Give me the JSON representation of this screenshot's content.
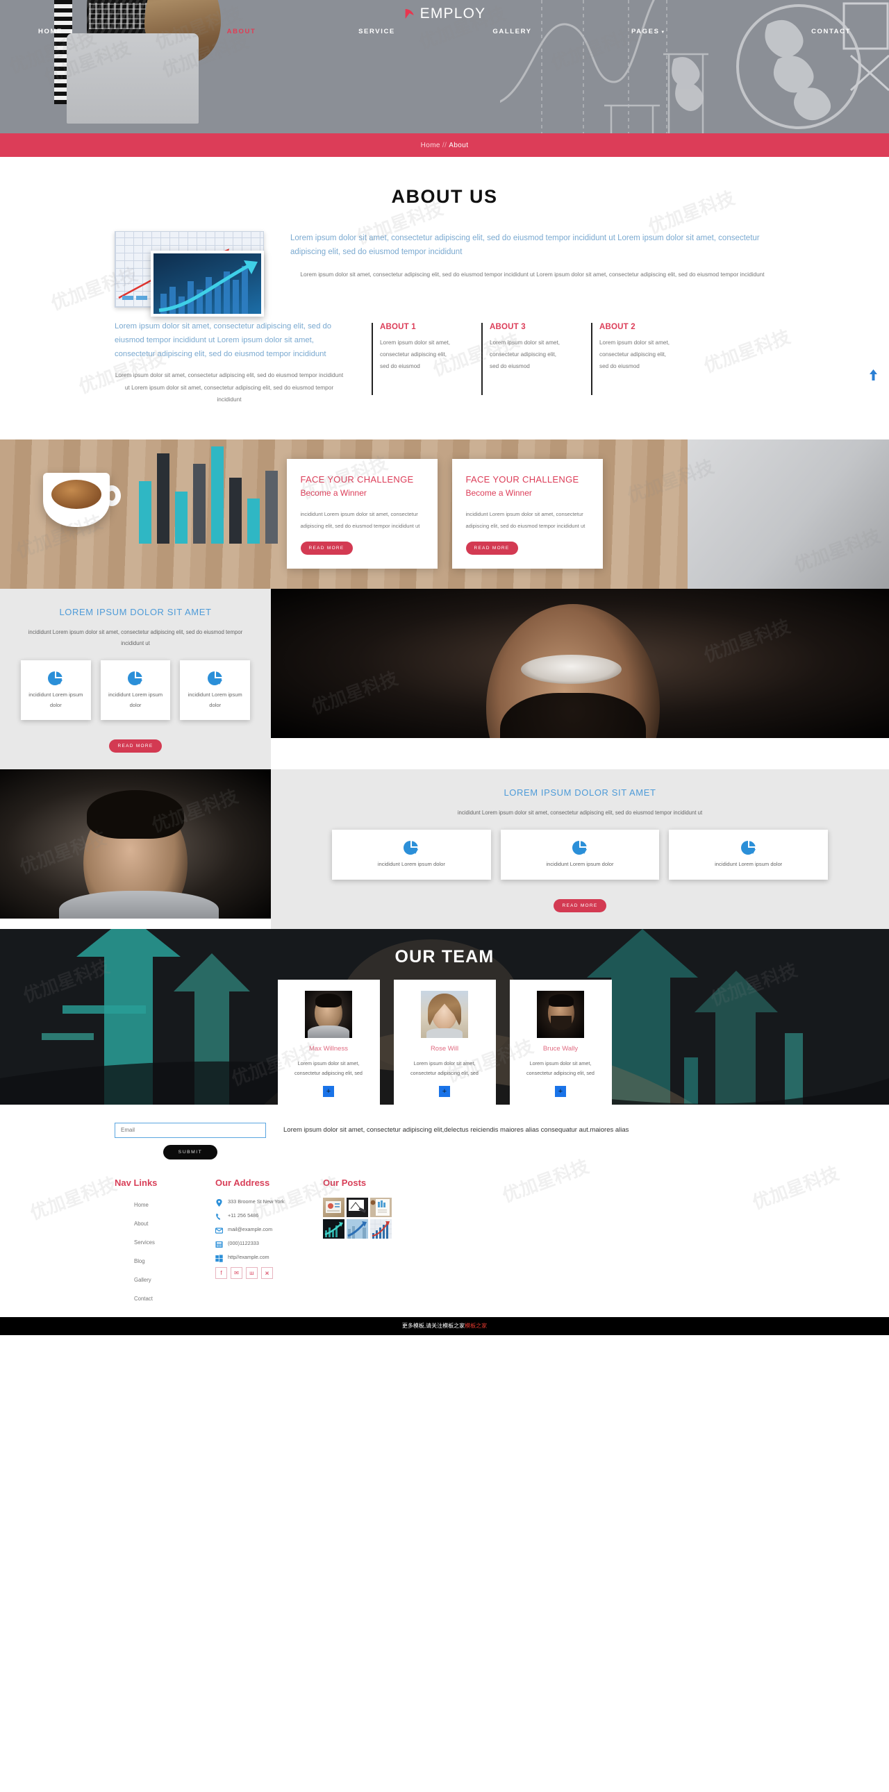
{
  "brand": {
    "name": "EMPLOY",
    "logo_icon": "flag-mark-icon",
    "accent": "#dc3d58",
    "blue": "#4e9bd8"
  },
  "nav": {
    "items": [
      {
        "label": "HOME",
        "active": false
      },
      {
        "label": "ABOUT",
        "active": true
      },
      {
        "label": "SERVICE",
        "active": false
      },
      {
        "label": "GALLERY",
        "active": false
      },
      {
        "label": "PAGES",
        "active": false,
        "caret": "▾"
      },
      {
        "label": "CONTACT",
        "active": false
      }
    ]
  },
  "breadcrumb": {
    "home": "Home",
    "separator": "//",
    "current": "About"
  },
  "about": {
    "title": "ABOUT US",
    "lead_right": "Lorem ipsum dolor sit amet, consectetur adipiscing elit, sed do eiusmod tempor incididunt ut Lorem ipsum dolor sit amet, consectetur adipiscing elit, sed do eiusmod tempor incididunt",
    "sub_right": "Lorem ipsum dolor sit amet, consectetur adipiscing elit, sed do eiusmod tempor incididunt ut Lorem ipsum dolor sit amet, consectetur adipiscing elit, sed do eiusmod tempor incididunt",
    "lead_left": "Lorem ipsum dolor sit amet, consectetur adipiscing elit, sed do eiusmod tempor incididunt ut Lorem ipsum dolor sit amet, consectetur adipiscing elit, sed do eiusmod tempor incididunt",
    "sub_left": "Lorem ipsum dolor sit amet, consectetur adipiscing elit, sed do eiusmod tempor incididunt ut Lorem ipsum dolor sit amet, consectetur adipiscing elit, sed do eiusmod tempor incididunt",
    "features": [
      {
        "title": "ABOUT 1",
        "text": "Lorem ipsum dolor sit amet, consectetur adipiscing elit, sed do eiusmod"
      },
      {
        "title": "ABOUT 3",
        "text": "Lorem ipsum dolor sit amet, consectetur adipiscing elit, sed do eiusmod"
      },
      {
        "title": "ABOUT 2",
        "text": "Lorem ipsum dolor sit amet, consectetur adipiscing elit, sed do eiusmod"
      }
    ],
    "scroll_top_icon": "scroll-to-top-icon"
  },
  "challenge": {
    "cards": [
      {
        "heading": "FACE YOUR CHALLENGE",
        "subheading": "Become a Winner",
        "text": "incididunt Lorem ipsum dolor sit amet, consectetur adipiscing elit, sed do eiusmod tempor incididunt ut",
        "button": "READ MORE"
      },
      {
        "heading": "FACE YOUR CHALLENGE",
        "subheading": "Become a Winner",
        "text": "incididunt Lorem ipsum dolor sit amet, consectetur adipiscing elit, sed do eiusmod tempor incididunt ut",
        "button": "READ MORE"
      }
    ]
  },
  "services": [
    {
      "title": "LOREM IPSUM DOLOR SIT AMET",
      "desc": "incididunt Lorem ipsum dolor sit amet, consectetur adipiscing elit, sed do eiusmod tempor incididunt ut",
      "cards": [
        {
          "icon": "pie-chart-icon",
          "text": "incididunt Lorem ipsum dolor"
        },
        {
          "icon": "pie-chart-icon",
          "text": "incididunt Lorem ipsum dolor"
        },
        {
          "icon": "pie-chart-icon",
          "text": "incididunt Lorem ipsum dolor"
        }
      ],
      "button": "READ MORE"
    },
    {
      "title": "LOREM IPSUM DOLOR SIT AMET",
      "desc": "incididunt Lorem ipsum dolor sit amet, consectetur adipiscing elit, sed do eiusmod tempor incididunt ut",
      "cards": [
        {
          "icon": "pie-chart-icon",
          "text": "incididunt Lorem ipsum dolor"
        },
        {
          "icon": "pie-chart-icon",
          "text": "incididunt Lorem ipsum dolor"
        },
        {
          "icon": "pie-chart-icon",
          "text": "incididunt Lorem ipsum dolor"
        }
      ],
      "button": "READ MORE"
    }
  ],
  "team": {
    "title": "OUR TEAM",
    "members": [
      {
        "name": "Max Willness",
        "bio": "Lorem ipsum dolor sit amet, consectetur adipiscing elit, sed",
        "expand": "+"
      },
      {
        "name": "Rose Will",
        "bio": "Lorem ipsum dolor sit amet, consectetur adipiscing elit, sed",
        "expand": "+"
      },
      {
        "name": "Bruce Wally",
        "bio": "Lorem ipsum dolor sit amet, consectetur adipiscing elit, sed",
        "expand": "+"
      }
    ]
  },
  "footer": {
    "email_placeholder": "Email",
    "email_value": "",
    "submit_label": "SUBMIT",
    "blurb": "Lorem ipsum dolor sit amet, consectetur adipiscing elit,delectus reiciendis maiores alias consequatur aut.maiores alias",
    "nav": {
      "title": "Nav Links",
      "items": [
        "Home",
        "About",
        "Services",
        "Blog",
        "Gallery",
        "Contact"
      ]
    },
    "address": {
      "title": "Our Address",
      "lines": [
        {
          "icon": "location-pin-icon",
          "text": "333 Broome St New York"
        },
        {
          "icon": "phone-icon",
          "text": "+11 256 5486"
        },
        {
          "icon": "mail-icon",
          "text": "mail@example.com"
        },
        {
          "icon": "fax-icon",
          "text": "(000)1122333"
        },
        {
          "icon": "windows-icon",
          "text": "http//example.com"
        }
      ],
      "socials": [
        {
          "name": "facebook-icon",
          "glyph": "f"
        },
        {
          "name": "mail-icon",
          "glyph": "✉"
        },
        {
          "name": "rss-icon",
          "glyph": "ш"
        },
        {
          "name": "vk-icon",
          "glyph": "ж"
        }
      ]
    },
    "posts": {
      "title": "Our Posts",
      "count": 6
    },
    "bottom_text": "更多模板,请关注模板之家",
    "bottom_highlight": "模板之家"
  },
  "watermark": "优加星科技"
}
